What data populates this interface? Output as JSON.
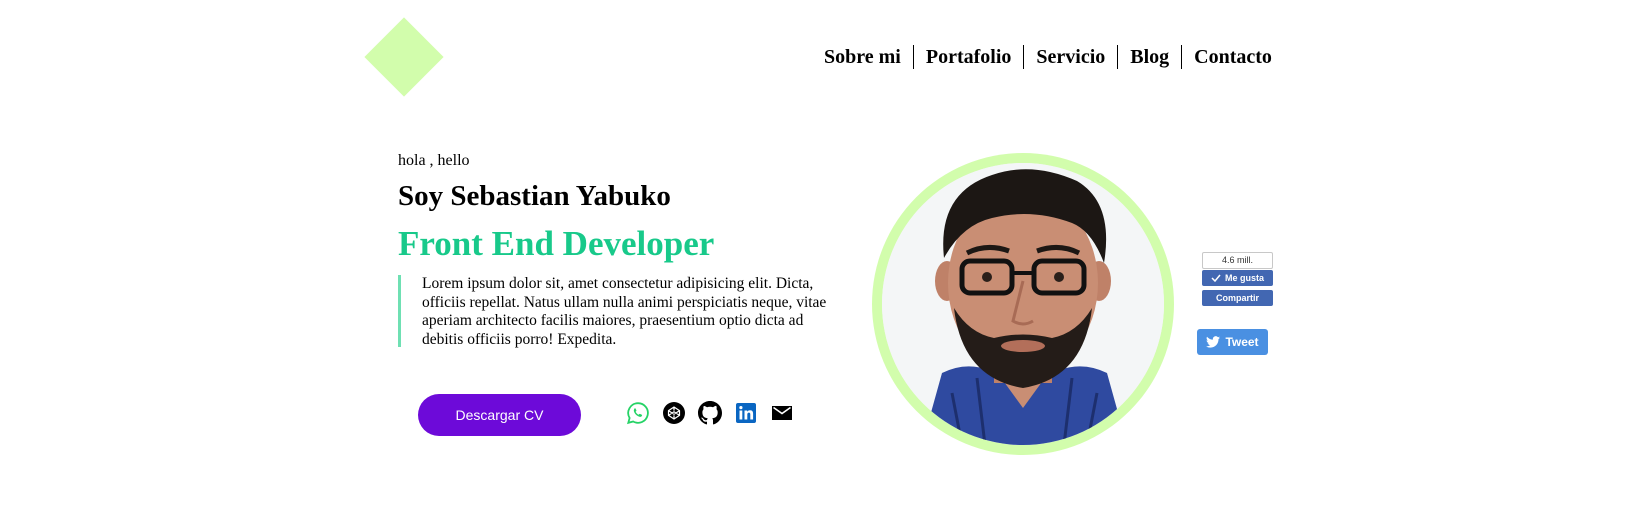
{
  "nav": {
    "items": [
      "Sobre mi",
      "Portafolio",
      "Servicio",
      "Blog",
      "Contacto"
    ]
  },
  "hero": {
    "greeting": "hola , hello",
    "name": "Soy Sebastian Yabuko",
    "role": "Front End Developer",
    "bio": "Lorem ipsum dolor sit, amet consectetur adipisicing elit. Dicta, officiis repellat. Natus ullam nulla animi perspiciatis neque, vitae aperiam architecto facilis maiores, praesentium optio dicta ad debitis officiis porro! Expedita.",
    "cv_button": "Descargar CV"
  },
  "social": {
    "icons": [
      "whatsapp-icon",
      "codepen-icon",
      "github-icon",
      "linkedin-icon",
      "email-icon"
    ]
  },
  "share": {
    "fb_count": "4.6 mill.",
    "fb_like": "Me gusta",
    "fb_share": "Compartir",
    "tweet": "Tweet"
  },
  "colors": {
    "accent_green": "#d2fdac",
    "role_green": "#18c98a",
    "button_purple": "#6d0ad9",
    "facebook_blue": "#4267b2",
    "twitter_blue": "#4a90e2"
  }
}
